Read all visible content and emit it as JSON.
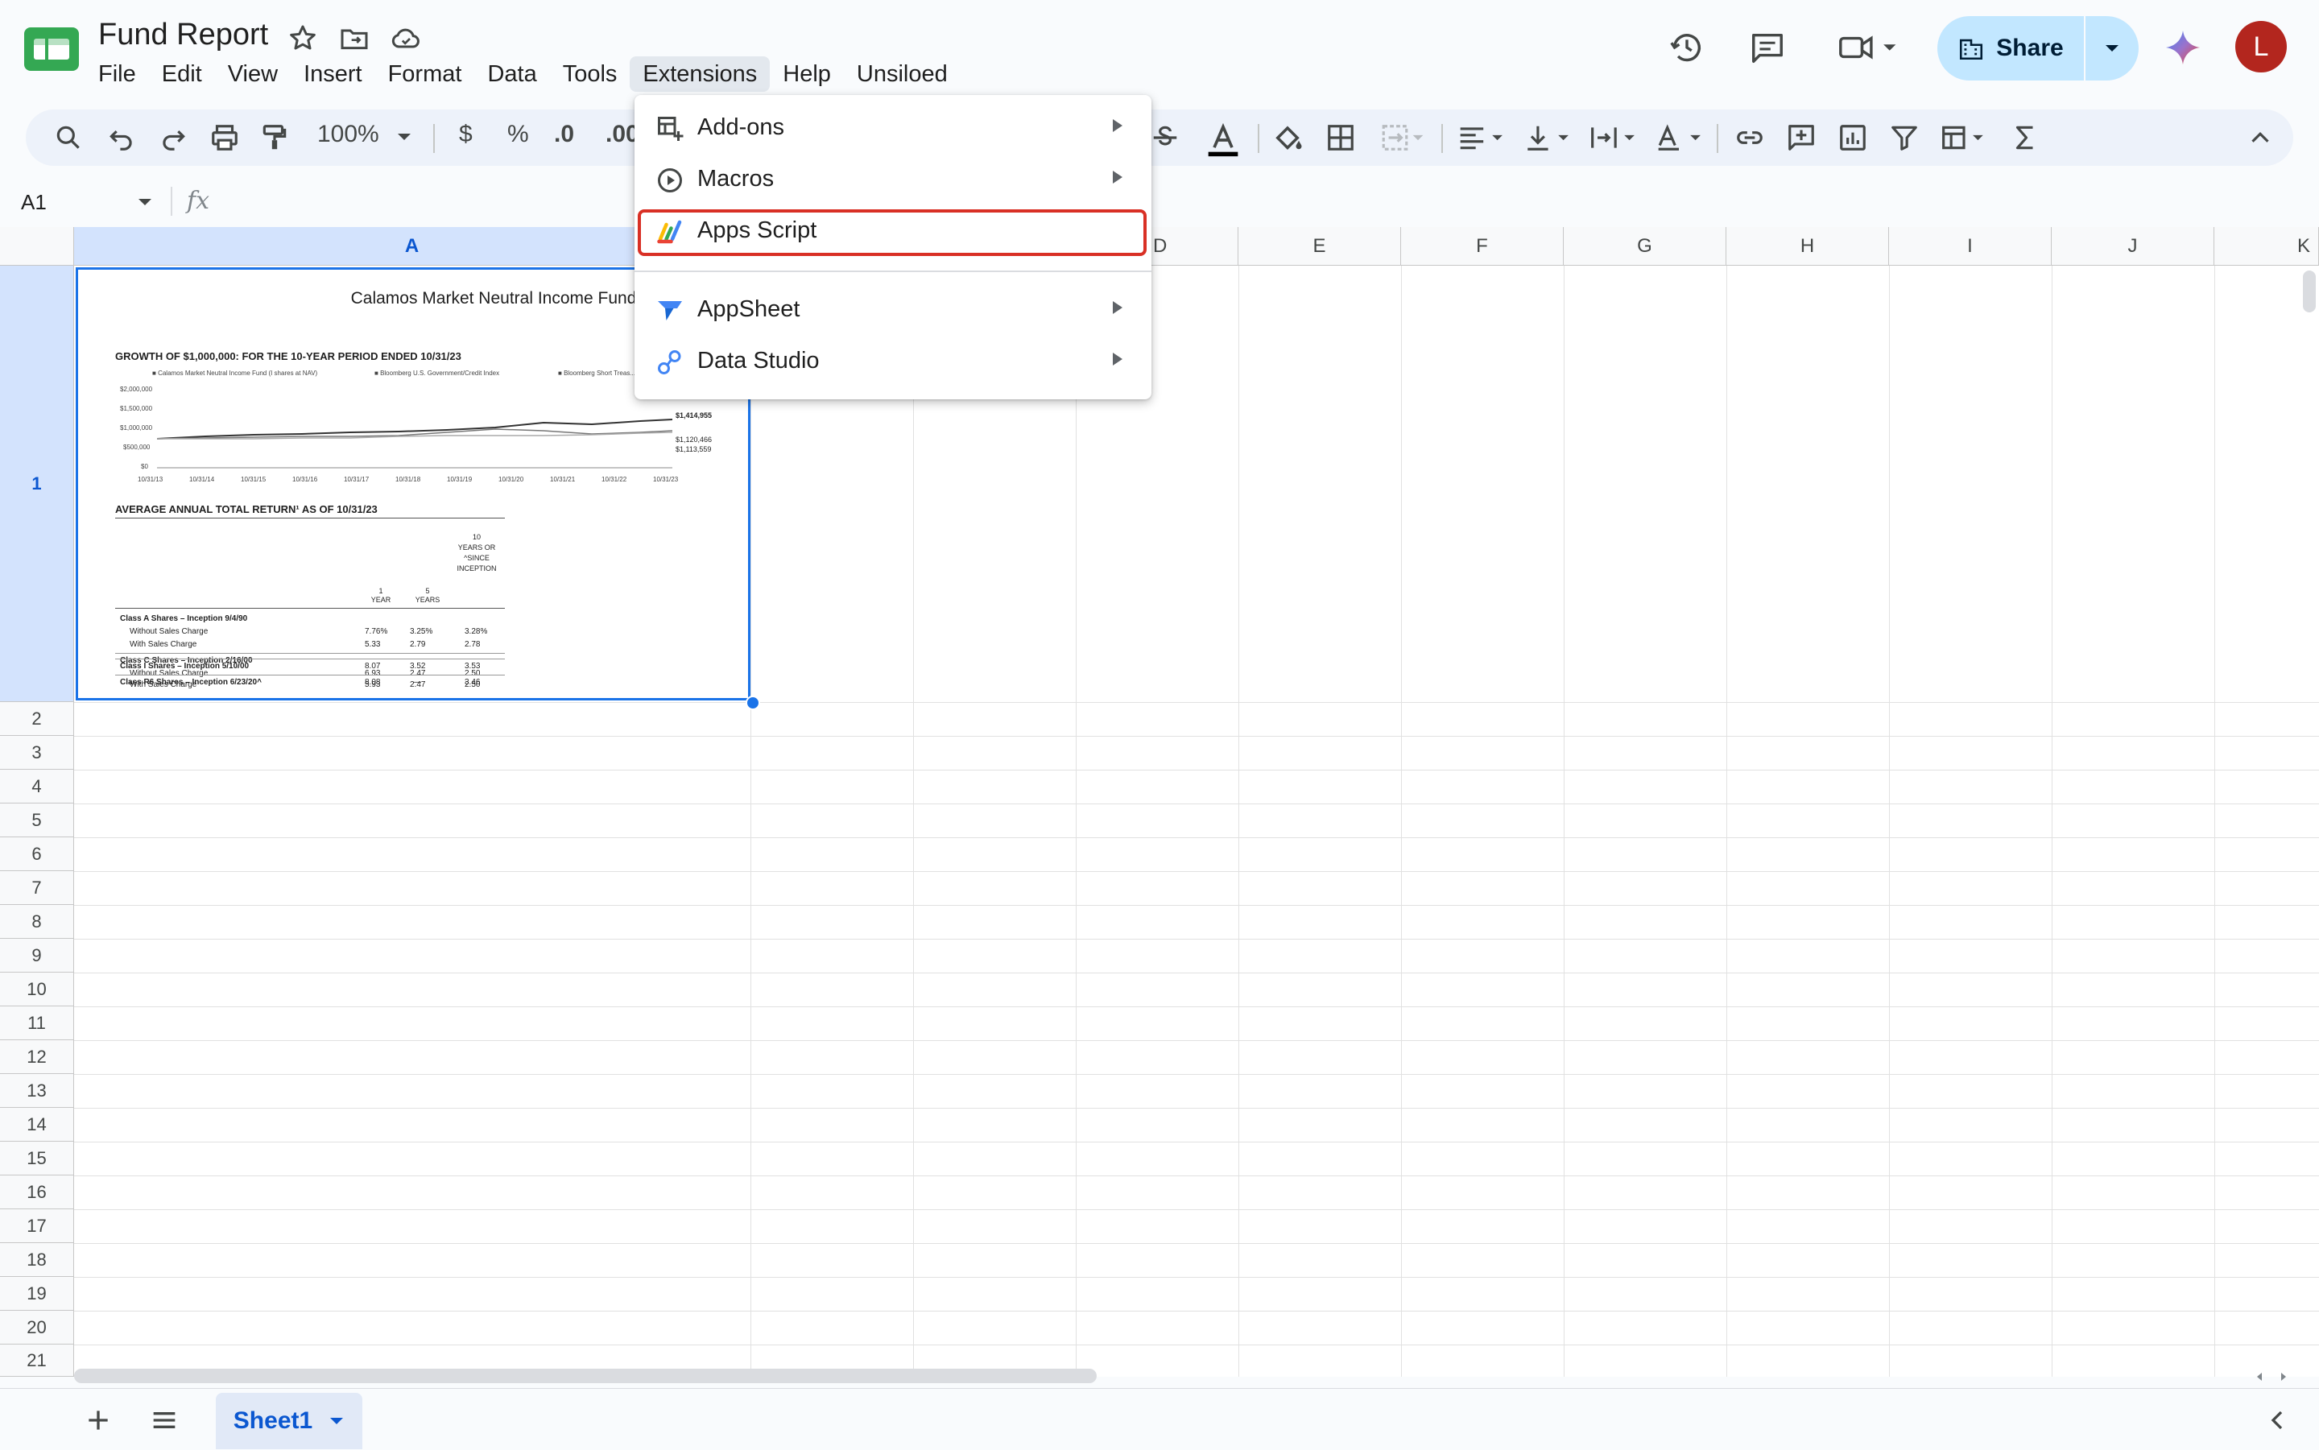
{
  "doc": {
    "title": "Fund Report"
  },
  "menubar": [
    "File",
    "Edit",
    "View",
    "Insert",
    "Format",
    "Data",
    "Tools",
    "Extensions",
    "Help",
    "Unsiloed"
  ],
  "share": {
    "label": "Share"
  },
  "avatar": {
    "initial": "L"
  },
  "toolbar": {
    "zoom": "100%",
    "currency": "$",
    "percent": "%",
    "dec_decrease": ".0",
    "dec_increase": ".00"
  },
  "formula_bar": {
    "cell_ref": "A1",
    "fx": "fx"
  },
  "columns": [
    "A",
    "B",
    "C",
    "D",
    "E",
    "F",
    "G",
    "H",
    "I",
    "J",
    "K"
  ],
  "rows": [
    "1",
    "2",
    "3",
    "4",
    "5",
    "6",
    "7",
    "8",
    "9",
    "10",
    "11",
    "12",
    "13",
    "14",
    "15",
    "16",
    "17",
    "18",
    "19",
    "20",
    "21"
  ],
  "extensions_menu": {
    "items": [
      "Add-ons",
      "Macros",
      "Apps Script",
      "AppSheet",
      "Data Studio"
    ]
  },
  "report": {
    "title": "Calamos Market Neutral Income Fund",
    "growth_heading": "GROWTH OF $1,000,000: FOR THE 10-YEAR PERIOD ENDED 10/31/23",
    "legend": [
      "Calamos Market Neutral Income Fund (I shares at NAV)",
      "Bloomberg U.S. Government/Credit Index",
      "Bloomberg Short Treas..."
    ],
    "y_ticks": [
      "$2,000,000",
      "$1,500,000",
      "$1,000,000",
      "$500,000",
      "$0"
    ],
    "x_ticks": [
      "10/31/13",
      "10/31/14",
      "10/31/15",
      "10/31/16",
      "10/31/17",
      "10/31/18",
      "10/31/19",
      "10/31/20",
      "10/31/21",
      "10/31/22",
      "10/31/23"
    ],
    "end_values": [
      "$1,414,955",
      "$1,120,466",
      "$1,113,559"
    ],
    "returns_heading": "AVERAGE ANNUAL TOTAL RETURN¹ AS OF 10/31/23",
    "col_1": [
      "1",
      "YEAR"
    ],
    "col_5": [
      "5",
      "YEARS"
    ],
    "col_10": [
      "10",
      "YEARS OR",
      "^SINCE",
      "INCEPTION"
    ],
    "rows": [
      {
        "label": "Class A Shares – Inception 9/4/90",
        "v1": "",
        "v5": "",
        "v10": "",
        "bold": true
      },
      {
        "label": "Without Sales Charge",
        "v1": "7.76%",
        "v5": "3.25%",
        "v10": "3.28%",
        "bold": false
      },
      {
        "label": "With Sales Charge",
        "v1": "5.33",
        "v5": "2.79",
        "v10": "2.78",
        "bold": false
      },
      {
        "label": "Class C Shares – Inception 2/16/00",
        "v1": "",
        "v5": "",
        "v10": "",
        "bold": true
      },
      {
        "label": "Without Sales Charge",
        "v1": "6.93",
        "v5": "2.47",
        "v10": "2.50",
        "bold": false
      },
      {
        "label": "With Sales Charge",
        "v1": "5.93",
        "v5": "2.47",
        "v10": "2.50",
        "bold": false
      },
      {
        "label": "Class I Shares – Inception 5/10/00",
        "v1": "8.07",
        "v5": "3.52",
        "v10": "3.53",
        "bold": true
      },
      {
        "label": "Class R6 Shares – Inception 6/23/20^",
        "v1": "8.08",
        "v5": "—",
        "v10": "3.46",
        "bold": true
      }
    ]
  },
  "sheets": {
    "active": "Sheet1"
  },
  "colors": {
    "accent": "#1a73e8",
    "share_bg": "#c2e7ff",
    "highlight": "#d93025",
    "avatar": "#b3261e"
  }
}
